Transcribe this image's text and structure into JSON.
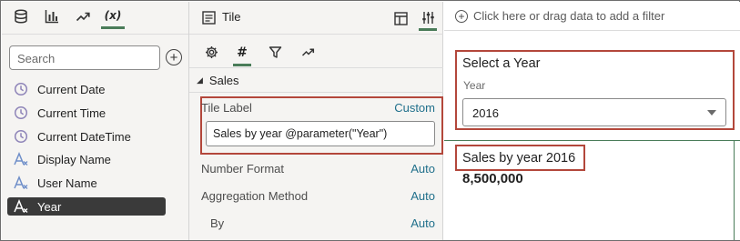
{
  "left_panel": {
    "tabs": [
      {
        "icon": "database-icon"
      },
      {
        "icon": "bar-chart-icon"
      },
      {
        "icon": "trend-icon"
      },
      {
        "icon": "function-icon",
        "label": "(x)"
      }
    ],
    "search_placeholder": "Search",
    "items": [
      {
        "label": "Current Date",
        "icon": "clock-icon"
      },
      {
        "label": "Current Time",
        "icon": "clock-icon"
      },
      {
        "label": "Current DateTime",
        "icon": "clock-icon"
      },
      {
        "label": "Display Name",
        "icon": "text-variable-icon"
      },
      {
        "label": "User Name",
        "icon": "text-variable-icon"
      },
      {
        "label": "Year",
        "icon": "text-variable-icon"
      }
    ]
  },
  "middle_panel": {
    "title": "Tile",
    "section": "Sales",
    "tile_label": {
      "label": "Tile Label",
      "value_type": "Custom",
      "value": "Sales by year @parameter(\"Year\")"
    },
    "properties": [
      {
        "label": "Number Format",
        "value": "Auto"
      },
      {
        "label": "Aggregation Method",
        "value": "Auto"
      },
      {
        "label": "By",
        "value": "Auto"
      }
    ]
  },
  "canvas": {
    "filter_prompt": "Click here or drag data to add a filter",
    "parameter": {
      "title": "Select a Year",
      "label": "Year",
      "selected": "2016"
    },
    "tile": {
      "title": "Sales by year 2016",
      "value": "8,500,000"
    }
  },
  "colors": {
    "highlight_border": "#b3473b",
    "active_tab": "#4a7c59",
    "link_value": "#1f6f8b",
    "selected_item_bg": "#3a3a3a"
  }
}
